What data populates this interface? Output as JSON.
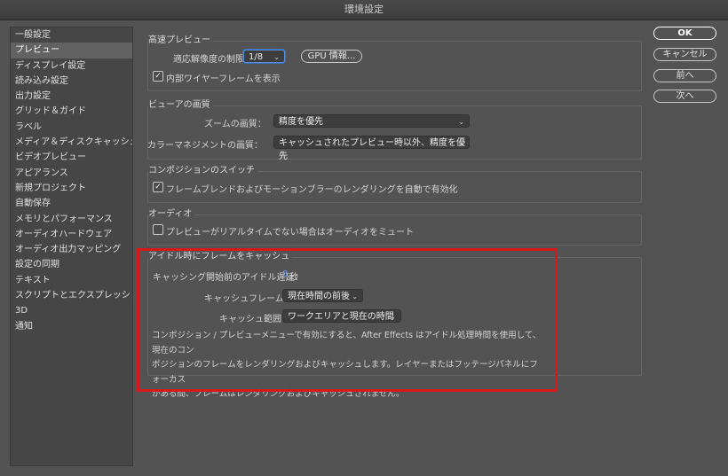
{
  "window": {
    "title": "環境設定"
  },
  "sidebar": {
    "items": [
      {
        "label": "一般設定"
      },
      {
        "label": "プレビュー",
        "selected": true
      },
      {
        "label": "ディスプレイ設定"
      },
      {
        "label": "読み込み設定"
      },
      {
        "label": "出力設定"
      },
      {
        "label": "グリッド＆ガイド"
      },
      {
        "label": "ラベル"
      },
      {
        "label": "メディア＆ディスクキャッシュ"
      },
      {
        "label": "ビデオプレビュー"
      },
      {
        "label": "アピアランス"
      },
      {
        "label": "新規プロジェクト"
      },
      {
        "label": "自動保存"
      },
      {
        "label": "メモリとパフォーマンス"
      },
      {
        "label": "オーディオハードウェア"
      },
      {
        "label": "オーディオ出力マッピング"
      },
      {
        "label": "設定の同期"
      },
      {
        "label": "テキスト"
      },
      {
        "label": "スクリプトとエクスプレッション"
      },
      {
        "label": "3D"
      },
      {
        "label": "通知"
      }
    ]
  },
  "fast_preview": {
    "title": "高速プレビュー",
    "resolution_label": "適応解像度の制限：",
    "resolution_value": "1/8",
    "gpu_button": "GPU 情報...",
    "wireframe_label": "内部ワイヤーフレームを表示",
    "wireframe_checked": "✓"
  },
  "viewer_quality": {
    "title": "ビューアの画質",
    "zoom_label": "ズームの画質：",
    "zoom_value": "精度を優先",
    "color_label": "カラーマネジメントの画質：",
    "color_value": "キャッシュされたプレビュー時以外、精度を優先"
  },
  "composition_switch": {
    "title": "コンポジションのスイッチ",
    "blend_label": "フレームブレンドおよびモーションブラーのレンダリングを自動で有効化",
    "blend_checked": "✓"
  },
  "audio": {
    "title": "オーディオ",
    "mute_label": "プレビューがリアルタイムでない場合はオーディオをミュート"
  },
  "idle_cache": {
    "title": "アイドル時にフレームをキャッシュ",
    "delay_label": "キャッシング開始前のアイドル遅延：",
    "delay_value": "8",
    "delay_unit": "秒",
    "frames_label": "キャッシュフレーム：",
    "frames_value": "現在時間の前後",
    "range_label": "キャッシュ範囲：",
    "range_value": "ワークエリアと現在の時間",
    "desc_line1": "コンポジション / プレビューメニューで有効にすると、After Effects はアイドル処理時間を使用して、現在のコン",
    "desc_line2": "ポジションのフレームをレンダリングおよびキャッシュします。レイヤーまたはフッテージパネルにフォーカス",
    "desc_line3": "がある間、フレームはレンダリングおよびキャッシュされません。"
  },
  "buttons": {
    "ok": "OK",
    "cancel": "キャンセル",
    "prev": "前へ",
    "next": "次へ"
  },
  "icons": {
    "chevron": "chevron-down-icon",
    "check": "checkmark-icon"
  },
  "colors": {
    "highlight": "#d7191c",
    "accent": "#6aa6ff"
  }
}
